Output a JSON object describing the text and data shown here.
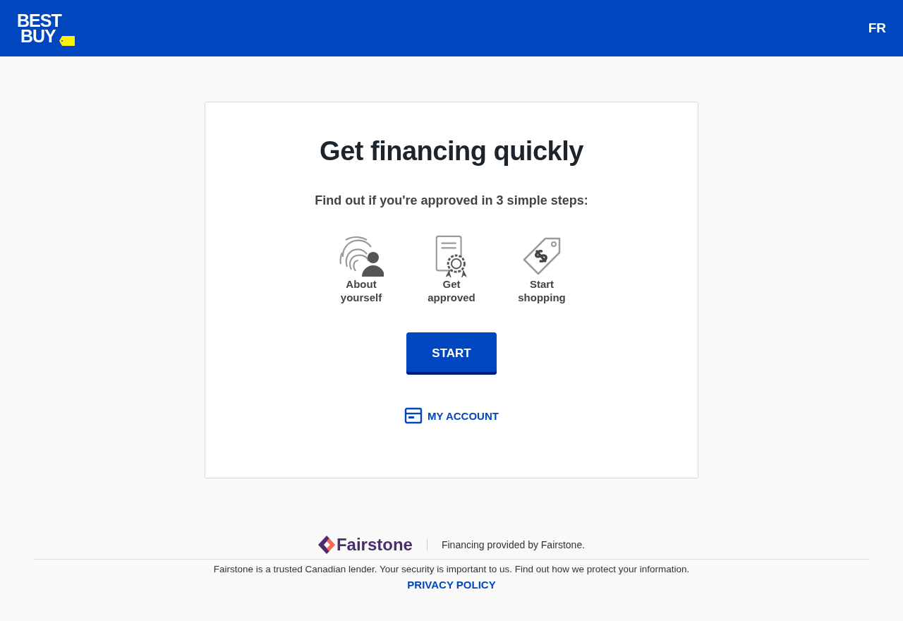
{
  "header": {
    "logo_lines": [
      "BEST",
      "BUY"
    ],
    "language_link": "FR"
  },
  "card": {
    "title": "Get financing quickly",
    "subtitle": "Find out if you're approved in 3 simple steps:",
    "steps": [
      {
        "kind": "identity",
        "label": "About yourself"
      },
      {
        "kind": "approval",
        "label": "Get approved"
      },
      {
        "kind": "shopping",
        "label": "Start shopping"
      }
    ],
    "start_button": "START",
    "account_link": "MY ACCOUNT"
  },
  "footer": {
    "partner_logo": "Fairstone",
    "partner_note": "Financing provided by Fairstone.",
    "trust_note": "Fairstone is a trusted Canadian lender. Your security is important to us. Find out how we protect your information.",
    "privacy_link": "PRIVACY POLICY"
  }
}
